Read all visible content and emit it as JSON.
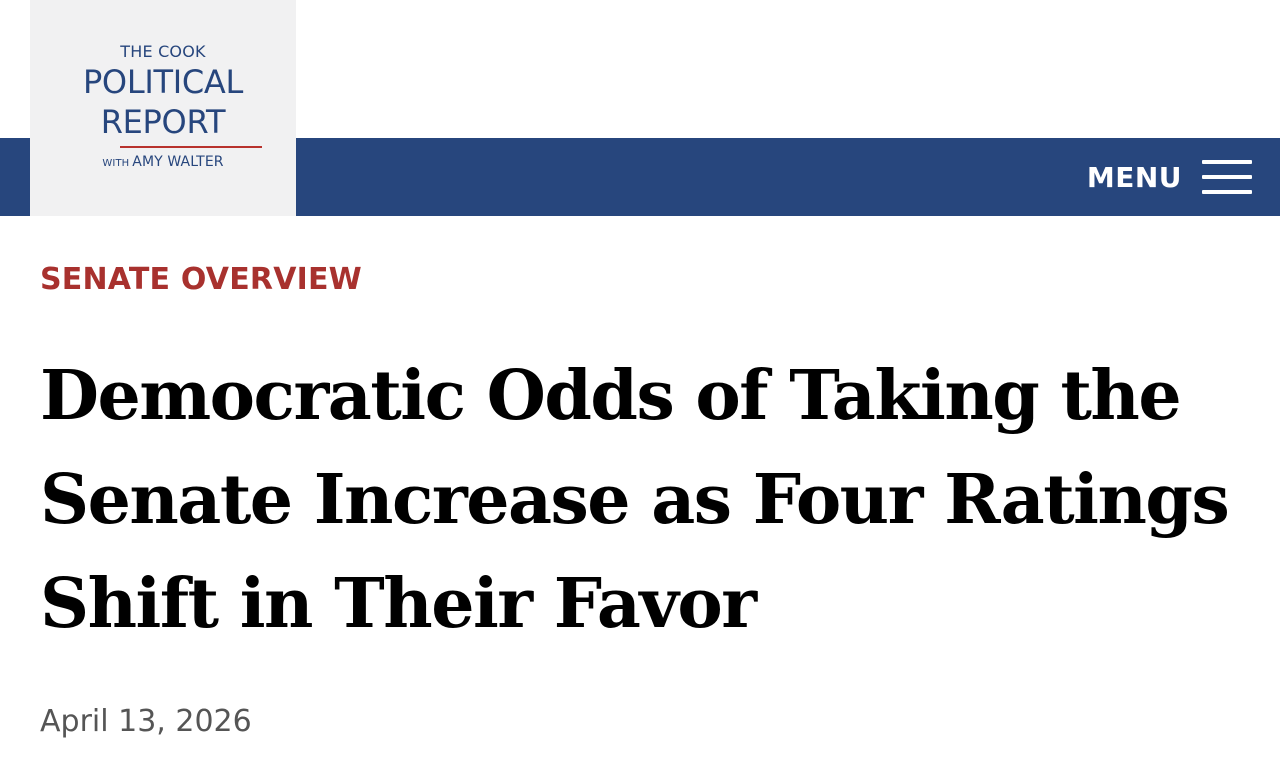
{
  "logo": {
    "line1": "THE COOK",
    "line2": "POLITICAL",
    "line3": "REPORT",
    "line4_with": "WITH",
    "line4_name": "AMY WALTER"
  },
  "nav": {
    "menu_label": "MENU",
    "menu_icon": "hamburger-menu-icon"
  },
  "article": {
    "kicker": "SENATE OVERVIEW",
    "headline": "Democratic Odds of Taking the Senate Increase as Four Ratings Shift in Their Favor",
    "date": "April 13, 2026"
  },
  "colors": {
    "nav_background": "#27467d",
    "logo_background": "#f1f1f2",
    "kicker": "#a8312e",
    "date": "#555555"
  }
}
